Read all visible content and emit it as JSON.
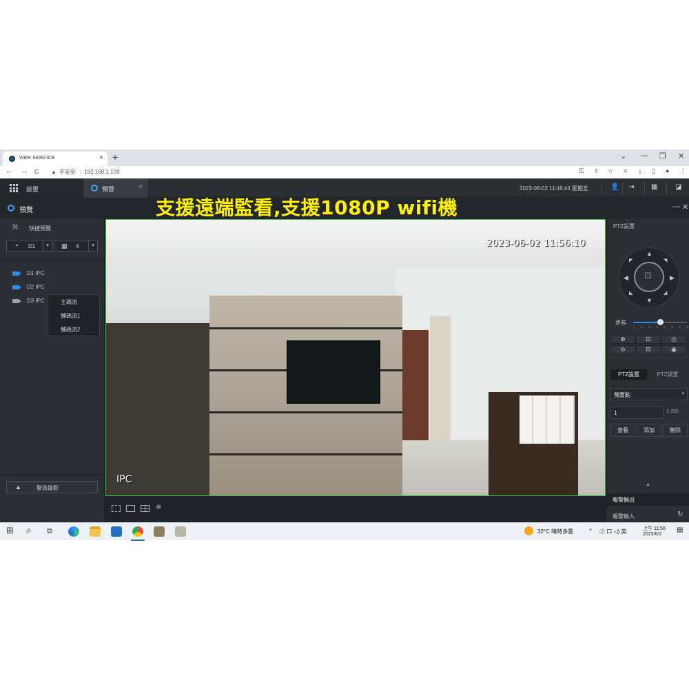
{
  "browser": {
    "tab_title": "WEB SERVICE",
    "tab_close": "×",
    "new_tab": "+",
    "security_label": "不安全",
    "separator": "|",
    "url": "192.168.1.109",
    "nav_back": "←",
    "nav_forward": "→",
    "nav_reload": "C",
    "win_minimize_chevron": "⌄",
    "win_min": "—",
    "win_restore": "❐",
    "win_close": "✕"
  },
  "app": {
    "tabs": [
      {
        "label": "設置"
      },
      {
        "label": "預覽"
      }
    ],
    "tab_close": "×",
    "datetime": "2023-06-02 11:46:44 星期五",
    "user_icon": "👤",
    "logout_icon": "⇥",
    "qr_icon": "▦",
    "screen_icon": "◪"
  },
  "preview_header": {
    "title": "預覽",
    "minimize": "—",
    "close": "✕"
  },
  "overlay_banner": "支援遠端監看,支援1080P wifi機",
  "left_panel": {
    "quick_preview": "快捷預覽",
    "channel_select": {
      "value": "D1",
      "arrow": "▾"
    },
    "layout_select": {
      "value": "4",
      "arrow": "▾"
    },
    "devices": [
      {
        "label": "D1 IPC",
        "active": true
      },
      {
        "label": "D2 IPC",
        "active": true
      },
      {
        "label": "D3 IPC",
        "active": false
      }
    ],
    "context_menu": [
      "主碼流",
      "輔碼流1",
      "輔碼流2"
    ],
    "emergency_record": "緊急錄影",
    "warning_glyph": "▲"
  },
  "video": {
    "osd_time": "2023-06-02 11:56:10",
    "osd_name": "IPC"
  },
  "ptz": {
    "title": "PTZ設置",
    "step_label": "步長",
    "step_value": 0.5,
    "step_numbers": [
      "1",
      "2",
      "3",
      "4",
      "5",
      "6",
      "7",
      "8"
    ],
    "arrows": {
      "up": "▲",
      "down": "▼",
      "left": "◀",
      "right": "▶",
      "ul": "◤",
      "ur": "◥",
      "dl": "◣",
      "dr": "◢"
    },
    "buttons": [
      "⊕",
      "⊡",
      "◎",
      "⊖",
      "⊟",
      "◉"
    ],
    "tabs": [
      "PTZ設置",
      "PTZ調置"
    ],
    "preset_label": "預置點",
    "preset_value": "1",
    "preset_range": "1-255",
    "actions": [
      "查看",
      "添加",
      "刪除"
    ],
    "collapse_glyph": "▲",
    "alarm_output": "報警輸出",
    "alarm_input": "報警輸入",
    "refresh_glyph": "↻"
  },
  "taskbar": {
    "start_icon": "⊞",
    "search_icon": "⌕",
    "taskview_icon": "⧉",
    "weather": "32°C  晴時多雲",
    "tray_chevron": "^",
    "tray_icons": "ⓔ 口 ◁) 英",
    "time": "上午 11:56",
    "date": "2023/6/2",
    "notify_icon": "▤"
  },
  "colors": {
    "accent_blue": "#2f8fe8",
    "banner_yellow": "#fff200",
    "video_border_green": "#3fbf3f",
    "panel_bg": "#2b2f34"
  }
}
